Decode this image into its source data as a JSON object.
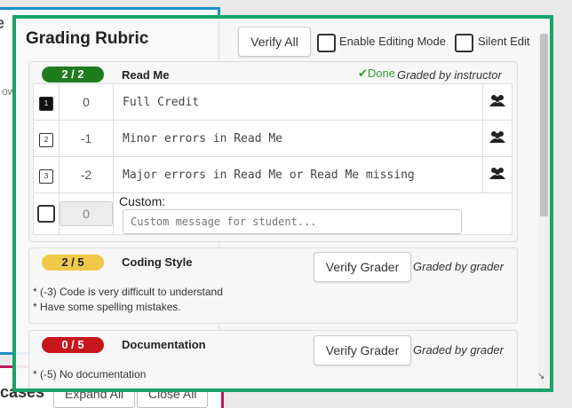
{
  "background": {
    "title": "Re",
    "text1": "ow",
    "text2": "F",
    "cases_label": "cases",
    "expand_all": "Expand All",
    "close_all": "Close All"
  },
  "modal": {
    "title": "Grading Rubric",
    "verify_all": "Verify All",
    "enable_editing": "Enable Editing Mode",
    "silent_edit": "Silent Edit"
  },
  "sections": [
    {
      "score": "2 / 2",
      "title": "Read Me",
      "done": "Done",
      "graded_by": "Graded by instructor",
      "items": [
        {
          "key": "1",
          "points": "0",
          "text": "Full Credit"
        },
        {
          "key": "2",
          "points": "-1",
          "text": "Minor errors in Read Me"
        },
        {
          "key": "3",
          "points": "-2",
          "text": "Major errors in Read Me or Read Me missing"
        }
      ],
      "custom_points": "0",
      "custom_label": "Custom:",
      "custom_placeholder": "Custom message for student..."
    },
    {
      "score": "2 / 5",
      "title": "Coding Style",
      "verify_grader": "Verify Grader",
      "graded_by": "Graded by grader",
      "comments": [
        "* (-3) Code is very difficult to understand",
        "* Have some spelling mistakes."
      ]
    },
    {
      "score": "0 / 5",
      "title": "Documentation",
      "verify_grader": "Verify Grader",
      "graded_by": "Graded by grader",
      "comments": [
        "* (-5) No documentation"
      ]
    }
  ],
  "colors": {
    "accent_border": "#18a36a",
    "score_full": "#1e7b1e",
    "score_partial": "#f0c94a",
    "score_zero": "#c8161d",
    "done": "#2f9c2f"
  }
}
